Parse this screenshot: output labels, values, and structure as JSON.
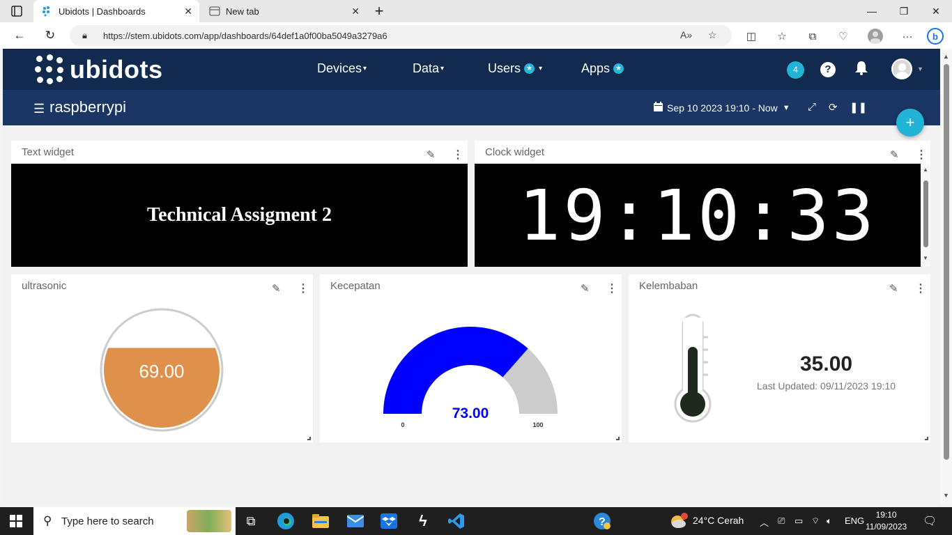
{
  "browser": {
    "tabs": [
      {
        "title": "Ubidots | Dashboards",
        "active": true
      },
      {
        "title": "New tab",
        "active": false
      }
    ],
    "url": "https://stem.ubidots.com/app/dashboards/64def1a0f00ba5049a3279a6"
  },
  "app": {
    "logo_text": "ubidots",
    "nav": {
      "devices": "Devices",
      "data": "Data",
      "users": "Users",
      "apps": "Apps"
    },
    "notification_count": "4",
    "help_glyph": "?",
    "dashboard_name": "raspberrypi",
    "date_range": "Sep 10 2023 19:10 - Now"
  },
  "widgets": {
    "text_widget": {
      "title": "Text widget",
      "content": "Technical Assigment 2"
    },
    "clock_widget": {
      "title": "Clock widget",
      "time": "19:10:33"
    },
    "ultrasonic": {
      "title": "ultrasonic",
      "value": "69.00",
      "fill_fraction": 0.69,
      "color": "#df904a"
    },
    "kecepatan": {
      "title": "Kecepatan",
      "value": "73.00",
      "min": "0",
      "max": "100",
      "fraction": 0.73,
      "color": "#0000ff"
    },
    "kelembaban": {
      "title": "Kelembaban",
      "value": "35.00",
      "last_updated": "Last Updated: 09/11/2023 19:10"
    }
  },
  "taskbar": {
    "search_placeholder": "Type here to search",
    "weather": "24°C  Cerah",
    "language": "ENG",
    "time": "19:10",
    "date": "11/09/2023"
  }
}
